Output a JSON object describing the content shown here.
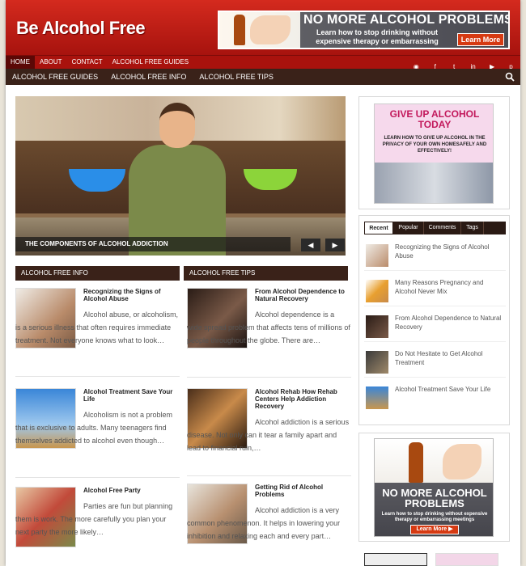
{
  "site": {
    "title": "Be Alcohol Free"
  },
  "header_banner": {
    "headline": "NO MORE ALCOHOL PROBLEMS",
    "subline": "Learn how to stop drinking without expensive therapy or embarrassing meetings",
    "button": "Learn More ▶"
  },
  "nav_primary": [
    {
      "label": "HOME",
      "active": true
    },
    {
      "label": "ABOUT"
    },
    {
      "label": "CONTACT"
    },
    {
      "label": "ALCOHOL FREE GUIDES"
    }
  ],
  "social_icons": [
    "rss-icon",
    "facebook-icon",
    "twitter-icon",
    "linkedin-icon",
    "youtube-icon",
    "pinterest-icon"
  ],
  "nav_secondary": [
    "ALCOHOL FREE GUIDES",
    "ALCOHOL FREE INFO",
    "ALCOHOL FREE TIPS"
  ],
  "slider": {
    "caption": "THE COMPONENTS OF ALCOHOL ADDICTION",
    "prev": "◀",
    "next": "▶"
  },
  "sections": [
    {
      "title": "ALCOHOL FREE INFO",
      "posts": [
        {
          "title": "Recognizing the Signs of Alcohol Abuse",
          "excerpt": "Alcohol abuse, or alcoholism, is a serious illness that often requires immediate treatment. Not everyone knows what to look…"
        },
        {
          "title": "Alcohol Treatment Save Your Life",
          "excerpt": "Alcoholism is not a problem that is exclusive to adults. Many teenagers find themselves addicted to alcohol even though…"
        },
        {
          "title": "Alcohol Free Party",
          "excerpt": "Parties are fun but planning them is work. The more carefully you plan your next party the more likely…"
        }
      ]
    },
    {
      "title": "ALCOHOL FREE TIPS",
      "posts": [
        {
          "title": "From Alcohol Dependence to Natural Recovery",
          "excerpt": "Alcohol dependence is a wide spread problem that affects tens of millions of people throughout the globe. There are…"
        },
        {
          "title": "Alcohol Rehab How Rehab Centers Help Addiction Recovery",
          "excerpt": "Alcohol addiction is a serious disease. Not only can it tear a family apart and lead to financial ruin,…"
        },
        {
          "title": "Getting Rid of Alcohol Problems",
          "excerpt": "Alcohol addiction is a very common phenomenon. It helps in lowering your inhibition and relaxing each and every part…"
        }
      ]
    }
  ],
  "sidebar_ad_top": {
    "headline": "GIVE UP ALCOHOL TODAY",
    "body": "LEARN HOW TO GIVE UP ALCOHOL IN THE PRIVACY OF YOUR OWN HOMESAFELY AND EFFECTIVELY!"
  },
  "tabs": {
    "labels": [
      "Recent",
      "Popular",
      "Comments",
      "Tags"
    ],
    "active": "Recent",
    "items": [
      "Recognizing the Signs of Alcohol Abuse",
      "Many Reasons Pregnancy and Alcohol Never Mix",
      "From Alcohol Dependence to Natural Recovery",
      "Do Not Hesitate to Get Alcohol Treatment",
      "Alcohol Treatment Save Your Life"
    ]
  },
  "sidebar_ad_bottom": {
    "headline": "NO MORE ALCOHOL PROBLEMS",
    "subline": "Learn how to stop drinking without expensive therapy or embarrassing meetings",
    "button": "Learn More ▶"
  },
  "colors": {
    "brand_red": "#c41e14",
    "dark_brown": "#3a2219"
  }
}
